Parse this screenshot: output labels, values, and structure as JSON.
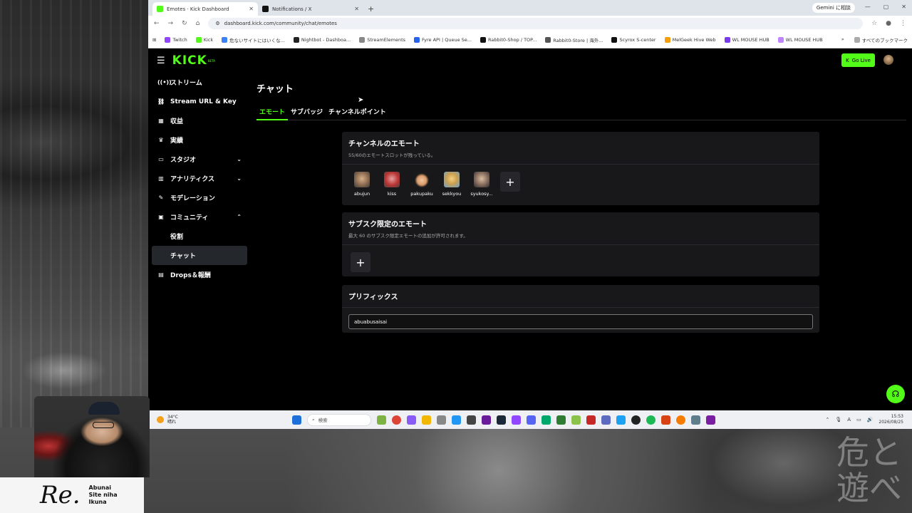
{
  "browser": {
    "tabs": [
      {
        "label": "Emotes · Kick Dashboard",
        "active": true
      },
      {
        "label": "Notifications / X",
        "active": false
      }
    ],
    "gemini_label": "Gemini に相談",
    "url": "dashboard.kick.com/community/chat/emotes",
    "bookmarks": [
      "Twitch",
      "Kick",
      "危ないサイトにはいくな...",
      "Nightbot - Dashboa...",
      "StreamElements",
      "Fyre API | Queue Se...",
      "Rabbit0-Shop / TOP...",
      "Rabbit0-Store | 海外...",
      "Scyrox S-center",
      "MelGeek Hive Web",
      "WL MOUSE HUB",
      "WL MOUSE HUB"
    ],
    "bookmarks_more": "»",
    "all_bookmarks": "すべてのブックマーク"
  },
  "header": {
    "logo": "KICK",
    "beta": "BETA",
    "go_live": "Go Live"
  },
  "sidebar": {
    "items": [
      {
        "label": "ストリーム",
        "icon": "((•))"
      },
      {
        "label": "Stream URL & Key",
        "icon": "⛓"
      },
      {
        "label": "収益",
        "icon": "▦"
      },
      {
        "label": "実績",
        "icon": "♛"
      },
      {
        "label": "スタジオ",
        "icon": "▭",
        "chev": "⌄"
      },
      {
        "label": "アナリティクス",
        "icon": "▥",
        "chev": "⌄"
      },
      {
        "label": "モデレーション",
        "icon": "✎"
      },
      {
        "label": "コミュニティ",
        "icon": "▣",
        "chev": "⌃"
      },
      {
        "label": "役割",
        "sub": true
      },
      {
        "label": "チャット",
        "sub": true,
        "active": true
      },
      {
        "label": "Drops＆報酬",
        "icon": "▤"
      }
    ]
  },
  "main": {
    "title": "チャット",
    "tabs": [
      "エモート",
      "サブバッジ",
      "チャンネルポイント"
    ],
    "channel_emotes": {
      "title": "チャンネルのエモート",
      "subtitle": "55/60のエモートスロットが残っている。",
      "emotes": [
        "abujun",
        "kiss",
        "pakupaku",
        "sekkyou",
        "syukosy..."
      ]
    },
    "sub_emotes": {
      "title": "サブスク限定のエモート",
      "subtitle": "最大 60 のサブスク限定エモートの追加が許可されます。"
    },
    "prefix": {
      "title": "プリフィックス",
      "value": "abuabusaisai"
    },
    "plus": "+"
  },
  "taskbar": {
    "temp": "34°C",
    "weather": "晴れ",
    "search_placeholder": "検索",
    "time": "15:53",
    "date": "2026/08/25"
  },
  "overlay": {
    "brand_mark": "Re.",
    "brand_lines": [
      "Abunai",
      "Site niha",
      "Ikuna"
    ],
    "watermark": "危と遊べ"
  },
  "colors": {
    "accent": "#53fc18",
    "card": "#18181b",
    "bg": "#000000"
  }
}
